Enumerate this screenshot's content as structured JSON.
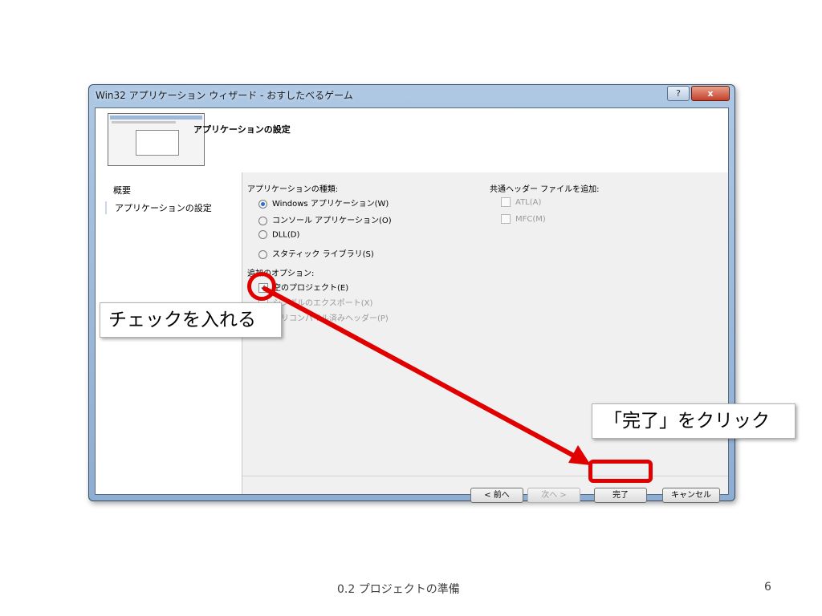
{
  "dialog": {
    "title": "Win32 アプリケーション ウィザード - おすしたべるゲーム",
    "help_label": "?",
    "close_label": "x",
    "header_title": "アプリケーションの設定",
    "sidebar": {
      "items": [
        {
          "label": "概要"
        },
        {
          "label": "アプリケーションの設定"
        }
      ]
    },
    "app_type": {
      "label": "アプリケーションの種類:",
      "options": [
        {
          "label": "Windows アプリケーション(W)",
          "selected": true
        },
        {
          "label": "コンソール アプリケーション(O)",
          "selected": false
        },
        {
          "label": "DLL(D)",
          "selected": false
        },
        {
          "label": "スタティック ライブラリ(S)",
          "selected": false
        }
      ]
    },
    "common_headers": {
      "label": "共通ヘッダー ファイルを追加:",
      "options": [
        {
          "label": "ATL(A)",
          "checked": false,
          "disabled": true
        },
        {
          "label": "MFC(M)",
          "checked": false,
          "disabled": true
        }
      ]
    },
    "additional_options": {
      "label": "追加のオプション:",
      "options": [
        {
          "label": "空のプロジェクト(E)",
          "checked": true,
          "disabled": false
        },
        {
          "label": "シンボルのエクスポート(X)",
          "checked": false,
          "disabled": true
        },
        {
          "label": "プリコンパイル済みヘッダー(P)",
          "checked": false,
          "disabled": true
        }
      ]
    },
    "buttons": {
      "prev": "< 前へ",
      "next": "次へ >",
      "finish": "完了",
      "cancel": "キャンセル"
    }
  },
  "annotations": {
    "check_callout": "チェックを入れる",
    "finish_callout": "「完了」をクリック",
    "highlight_color": "#e00000"
  },
  "slide": {
    "footer_title": "0.2 プロジェクトの準備",
    "page_number": "6"
  }
}
